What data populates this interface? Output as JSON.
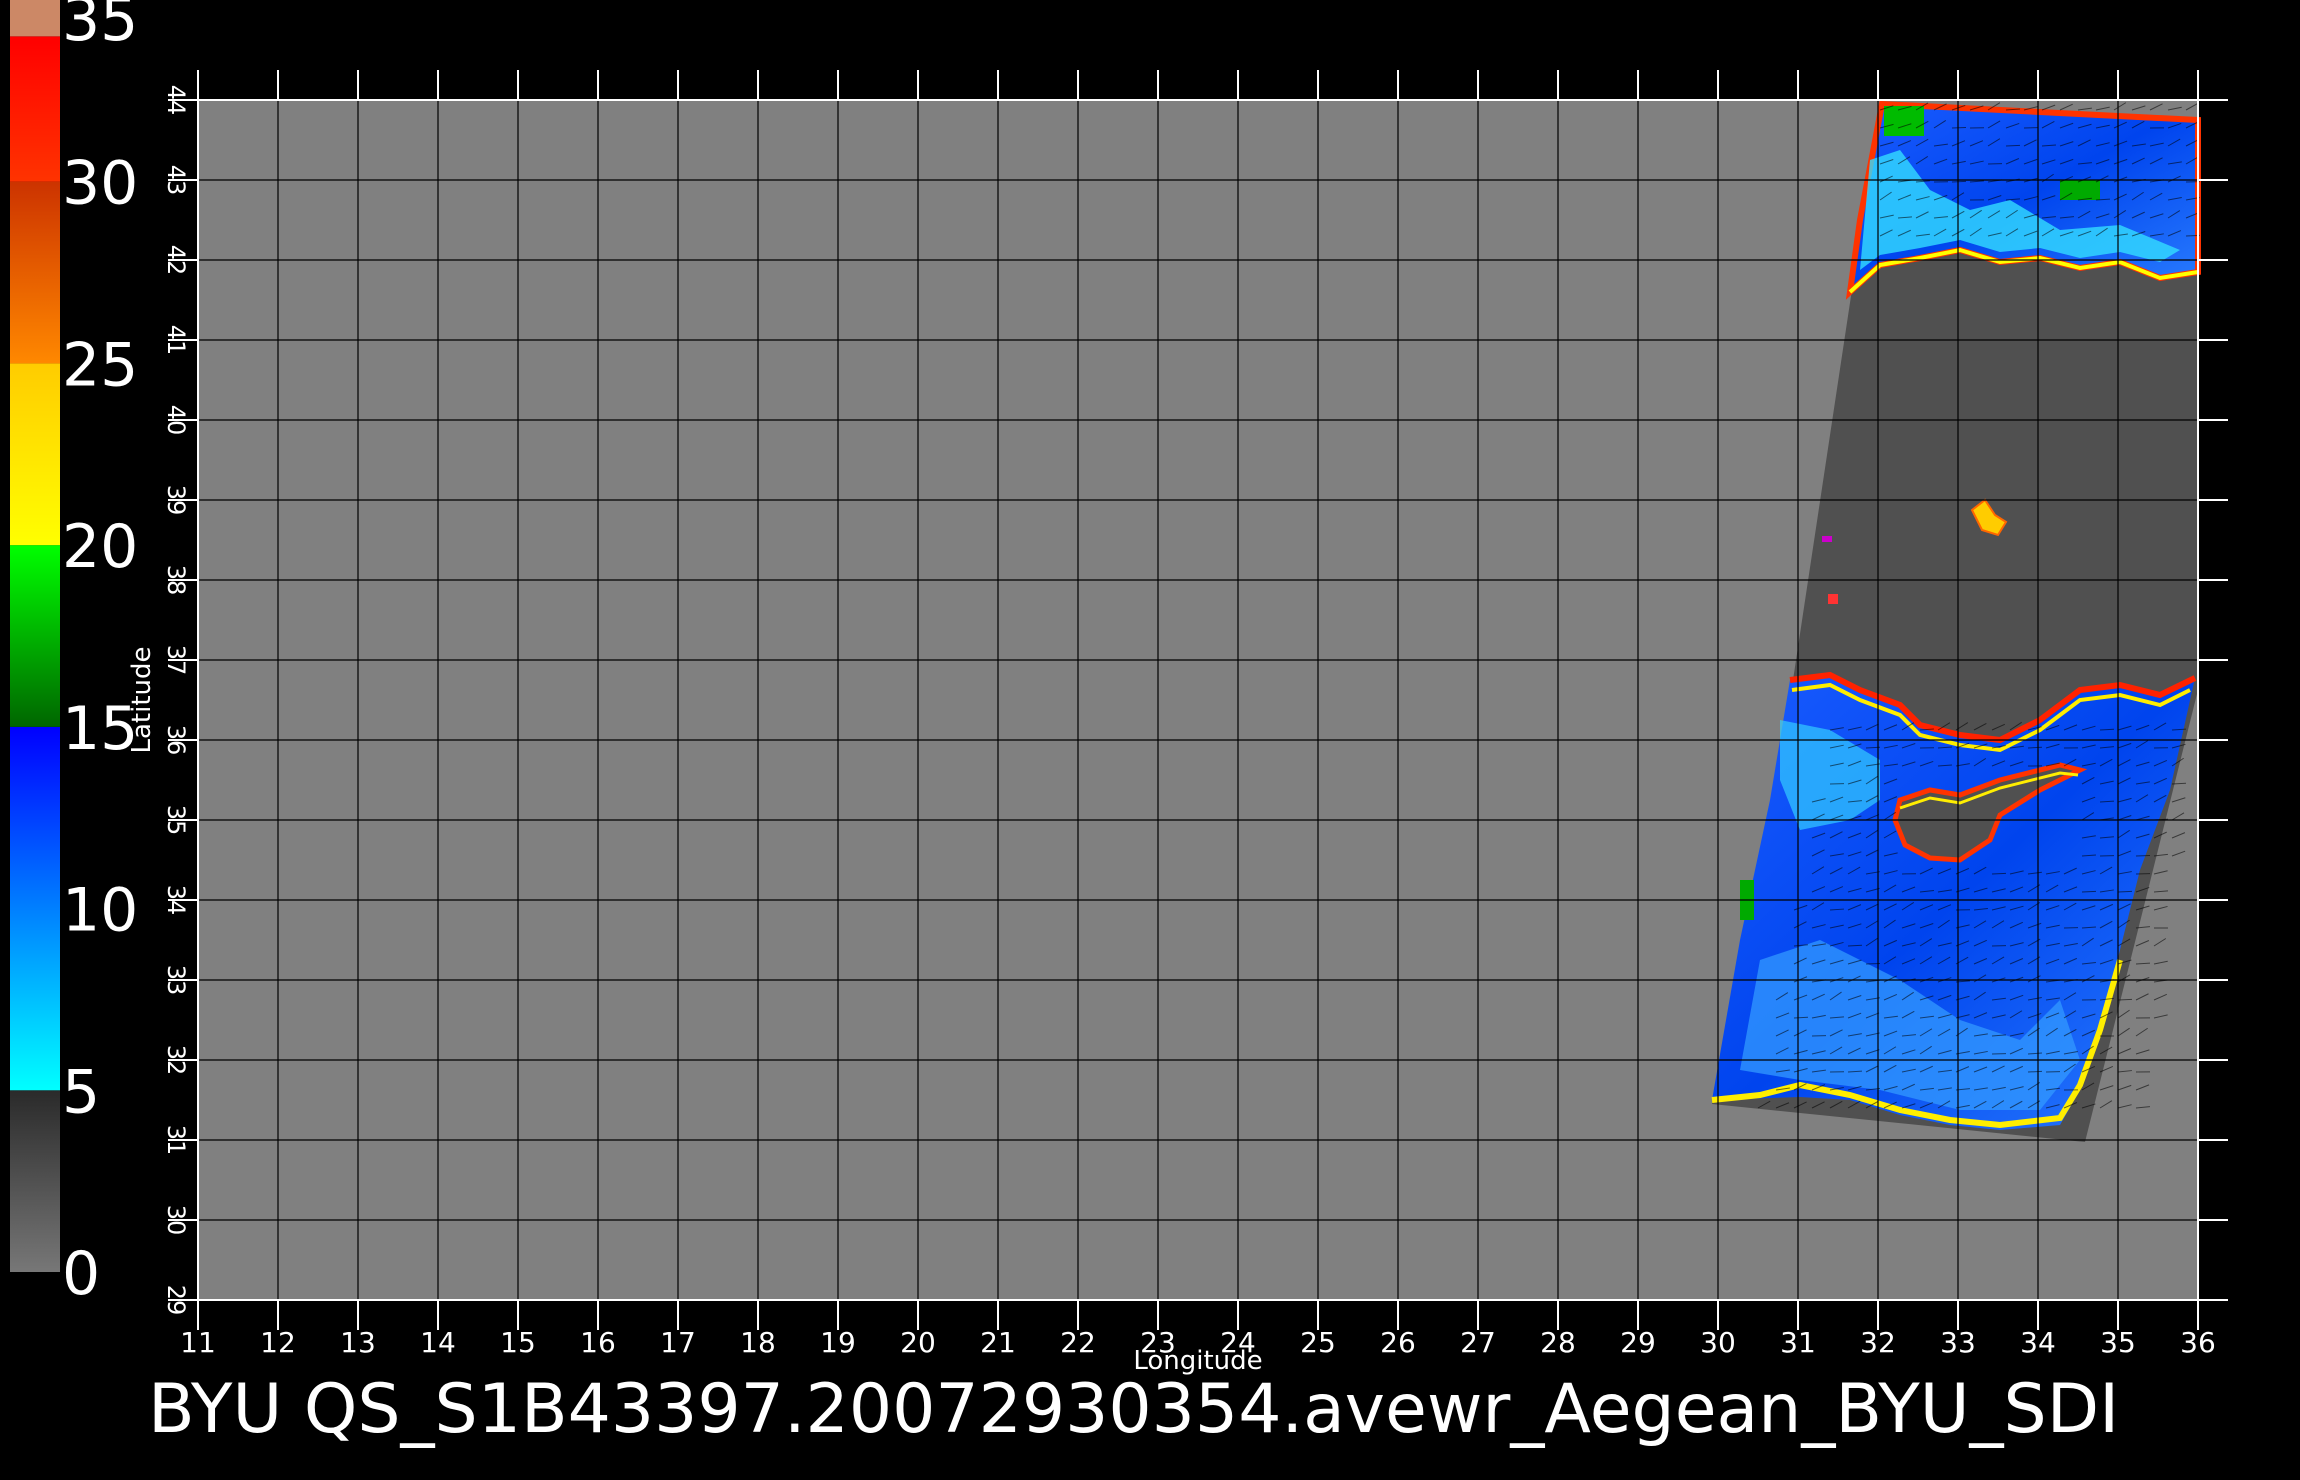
{
  "title": "BYU  QS_S1B43397.20072930354.avewr_Aegean_BYU_SDI",
  "axes": {
    "xlabel": "Longitude",
    "ylabel": "Latitude",
    "xlim": [
      11,
      36
    ],
    "ylim": [
      29,
      44
    ],
    "xticks": [
      "11",
      "12",
      "13",
      "14",
      "15",
      "16",
      "17",
      "18",
      "19",
      "20",
      "21",
      "22",
      "23",
      "24",
      "25",
      "26",
      "27",
      "28",
      "29",
      "30",
      "31",
      "32",
      "33",
      "34",
      "35",
      "36"
    ],
    "yticks": [
      "29",
      "30",
      "31",
      "32",
      "33",
      "34",
      "35",
      "36",
      "37",
      "38",
      "39",
      "40",
      "41",
      "42",
      "43",
      "44"
    ],
    "grid": true
  },
  "colorbar": {
    "labels": [
      "0",
      "5",
      "10",
      "15",
      "20",
      "25",
      "30",
      "35"
    ],
    "range": [
      0,
      35
    ],
    "bands": [
      {
        "from": 0,
        "to": 5,
        "colors": [
          "#777777",
          "#2a2a2a"
        ]
      },
      {
        "from": 5,
        "to": 15,
        "colors": [
          "#00ffff",
          "#0000ff"
        ]
      },
      {
        "from": 15,
        "to": 20,
        "colors": [
          "#006600",
          "#00ff00"
        ]
      },
      {
        "from": 20,
        "to": 25,
        "colors": [
          "#ffff00",
          "#ffcc00"
        ]
      },
      {
        "from": 25,
        "to": 30,
        "colors": [
          "#ff8800",
          "#cc3300"
        ]
      },
      {
        "from": 30,
        "to": 34,
        "colors": [
          "#ff3300",
          "#ff0000"
        ]
      },
      {
        "from": 34,
        "to": 35,
        "colors": [
          "#cc8866",
          "#cc8866"
        ]
      }
    ]
  },
  "colors": {
    "background": "#000000",
    "map_fill": "#808080",
    "swath_land": "#505050",
    "grid": "#000000",
    "axis": "#ffffff"
  }
}
